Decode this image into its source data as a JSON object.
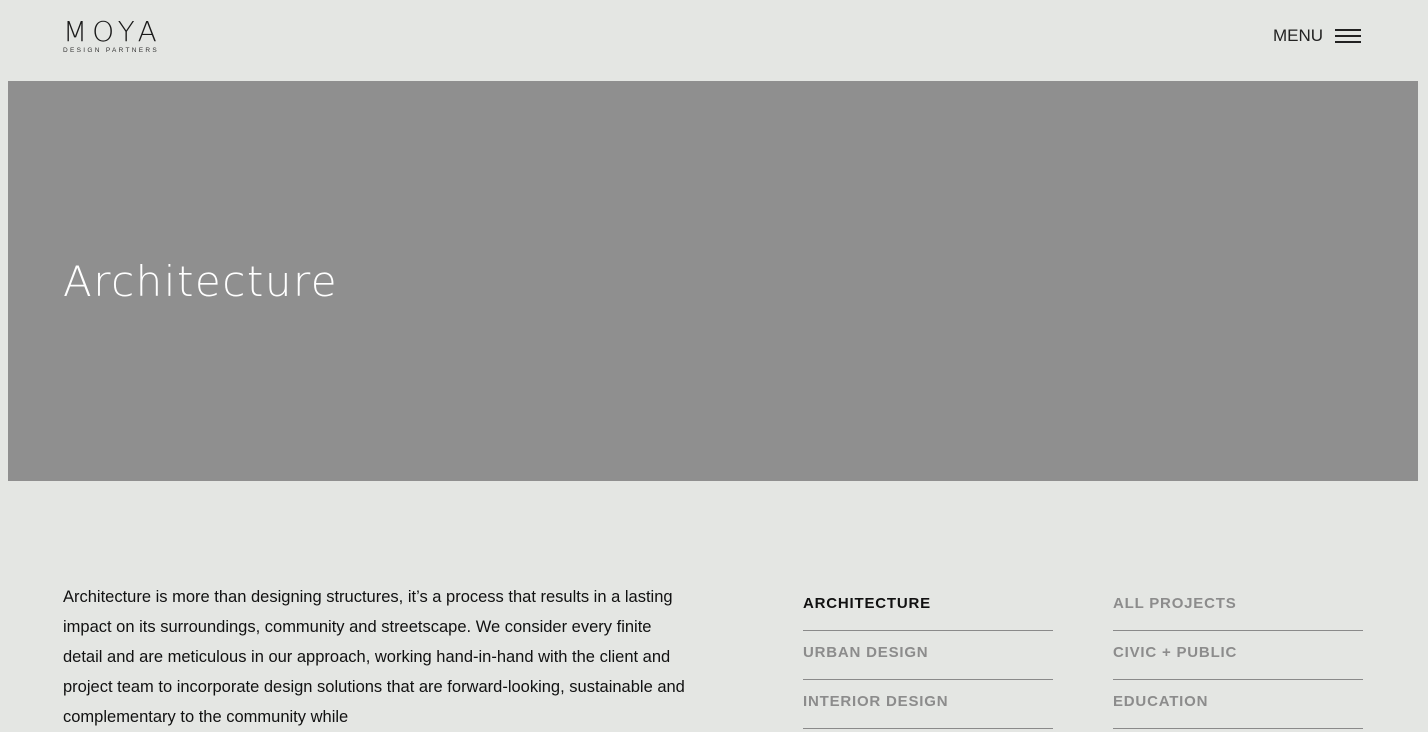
{
  "header": {
    "logo_main": "MOYA",
    "logo_sub": "DESIGN PARTNERS",
    "menu_label": "MENU"
  },
  "hero": {
    "title": "Architecture"
  },
  "intro": {
    "text": "Architecture is more than designing structures, it’s a process that results in a lasting impact on its surroundings, community and streetscape. We consider every finite detail and are meticulous in our approach, working hand-in-hand with the client and project team to incorporate design solutions that are forward-looking, sustainable and complementary to the community while"
  },
  "services": [
    {
      "label": "ARCHITECTURE",
      "active": true
    },
    {
      "label": "URBAN DESIGN"
    },
    {
      "label": "INTERIOR DESIGN"
    }
  ],
  "sectors": [
    {
      "label": "ALL PROJECTS"
    },
    {
      "label": "CIVIC + PUBLIC"
    },
    {
      "label": "EDUCATION"
    }
  ]
}
